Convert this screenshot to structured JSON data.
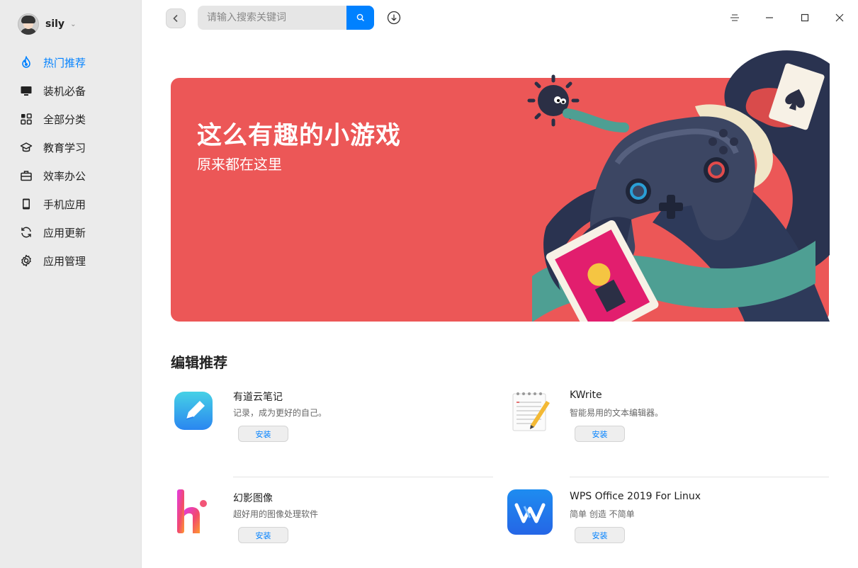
{
  "user": {
    "name": "sily"
  },
  "sidebar": {
    "items": [
      {
        "label": "热门推荐",
        "icon": "flame-icon",
        "active": true
      },
      {
        "label": "装机必备",
        "icon": "monitor-icon",
        "active": false
      },
      {
        "label": "全部分类",
        "icon": "grid-icon",
        "active": false
      },
      {
        "label": "教育学习",
        "icon": "graduation-cap-icon",
        "active": false
      },
      {
        "label": "效率办公",
        "icon": "briefcase-icon",
        "active": false
      },
      {
        "label": "手机应用",
        "icon": "phone-icon",
        "active": false
      },
      {
        "label": "应用更新",
        "icon": "refresh-icon",
        "active": false
      },
      {
        "label": "应用管理",
        "icon": "gear-icon",
        "active": false
      }
    ]
  },
  "search": {
    "placeholder": "请输入搜索关键词",
    "value": ""
  },
  "banner": {
    "title": "这么有趣的小游戏",
    "subtitle": "原来都在这里"
  },
  "section": {
    "title": "编辑推荐"
  },
  "apps": [
    {
      "name": "有道云笔记",
      "desc": "记录，成为更好的自己。",
      "install": "安装",
      "icon": "youdao-note-icon"
    },
    {
      "name": "KWrite",
      "desc": "智能易用的文本编辑器。",
      "install": "安装",
      "icon": "notepad-icon"
    },
    {
      "name": "幻影图像",
      "desc": "超好用的图像处理软件",
      "install": "安装",
      "icon": "hi-logo-icon"
    },
    {
      "name": "WPS Office 2019 For Linux",
      "desc": "简单 创造 不简单",
      "install": "安装",
      "icon": "wps-icon"
    }
  ],
  "colors": {
    "accent": "#0081ff",
    "banner": "#ec5757",
    "sidebar": "#ebebeb"
  }
}
